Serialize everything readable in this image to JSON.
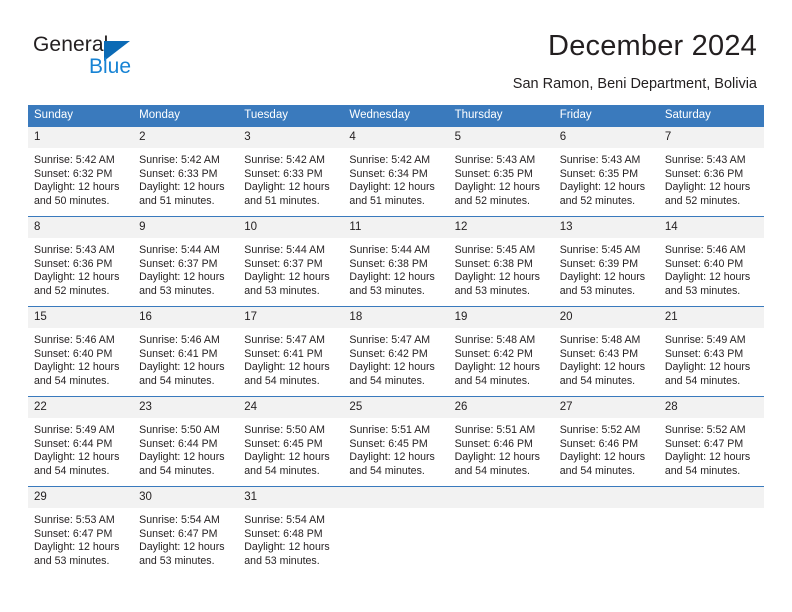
{
  "brand": {
    "name_top": "General",
    "name_bottom": "Blue",
    "triangle_color": "#0b6ab5",
    "blue_text_color": "#1783d4"
  },
  "header": {
    "title": "December 2024",
    "subtitle": "San Ramon, Beni Department, Bolivia",
    "header_bg": "#3a7abd",
    "header_text": "#ffffff"
  },
  "weekday_headers": [
    "Sunday",
    "Monday",
    "Tuesday",
    "Wednesday",
    "Thursday",
    "Friday",
    "Saturday"
  ],
  "weeks": [
    [
      {
        "day": "1",
        "sunrise": "Sunrise: 5:42 AM",
        "sunset": "Sunset: 6:32 PM",
        "daylight_line1": "Daylight: 12 hours",
        "daylight_line2": "and 50 minutes."
      },
      {
        "day": "2",
        "sunrise": "Sunrise: 5:42 AM",
        "sunset": "Sunset: 6:33 PM",
        "daylight_line1": "Daylight: 12 hours",
        "daylight_line2": "and 51 minutes."
      },
      {
        "day": "3",
        "sunrise": "Sunrise: 5:42 AM",
        "sunset": "Sunset: 6:33 PM",
        "daylight_line1": "Daylight: 12 hours",
        "daylight_line2": "and 51 minutes."
      },
      {
        "day": "4",
        "sunrise": "Sunrise: 5:42 AM",
        "sunset": "Sunset: 6:34 PM",
        "daylight_line1": "Daylight: 12 hours",
        "daylight_line2": "and 51 minutes."
      },
      {
        "day": "5",
        "sunrise": "Sunrise: 5:43 AM",
        "sunset": "Sunset: 6:35 PM",
        "daylight_line1": "Daylight: 12 hours",
        "daylight_line2": "and 52 minutes."
      },
      {
        "day": "6",
        "sunrise": "Sunrise: 5:43 AM",
        "sunset": "Sunset: 6:35 PM",
        "daylight_line1": "Daylight: 12 hours",
        "daylight_line2": "and 52 minutes."
      },
      {
        "day": "7",
        "sunrise": "Sunrise: 5:43 AM",
        "sunset": "Sunset: 6:36 PM",
        "daylight_line1": "Daylight: 12 hours",
        "daylight_line2": "and 52 minutes."
      }
    ],
    [
      {
        "day": "8",
        "sunrise": "Sunrise: 5:43 AM",
        "sunset": "Sunset: 6:36 PM",
        "daylight_line1": "Daylight: 12 hours",
        "daylight_line2": "and 52 minutes."
      },
      {
        "day": "9",
        "sunrise": "Sunrise: 5:44 AM",
        "sunset": "Sunset: 6:37 PM",
        "daylight_line1": "Daylight: 12 hours",
        "daylight_line2": "and 53 minutes."
      },
      {
        "day": "10",
        "sunrise": "Sunrise: 5:44 AM",
        "sunset": "Sunset: 6:37 PM",
        "daylight_line1": "Daylight: 12 hours",
        "daylight_line2": "and 53 minutes."
      },
      {
        "day": "11",
        "sunrise": "Sunrise: 5:44 AM",
        "sunset": "Sunset: 6:38 PM",
        "daylight_line1": "Daylight: 12 hours",
        "daylight_line2": "and 53 minutes."
      },
      {
        "day": "12",
        "sunrise": "Sunrise: 5:45 AM",
        "sunset": "Sunset: 6:38 PM",
        "daylight_line1": "Daylight: 12 hours",
        "daylight_line2": "and 53 minutes."
      },
      {
        "day": "13",
        "sunrise": "Sunrise: 5:45 AM",
        "sunset": "Sunset: 6:39 PM",
        "daylight_line1": "Daylight: 12 hours",
        "daylight_line2": "and 53 minutes."
      },
      {
        "day": "14",
        "sunrise": "Sunrise: 5:46 AM",
        "sunset": "Sunset: 6:40 PM",
        "daylight_line1": "Daylight: 12 hours",
        "daylight_line2": "and 53 minutes."
      }
    ],
    [
      {
        "day": "15",
        "sunrise": "Sunrise: 5:46 AM",
        "sunset": "Sunset: 6:40 PM",
        "daylight_line1": "Daylight: 12 hours",
        "daylight_line2": "and 54 minutes."
      },
      {
        "day": "16",
        "sunrise": "Sunrise: 5:46 AM",
        "sunset": "Sunset: 6:41 PM",
        "daylight_line1": "Daylight: 12 hours",
        "daylight_line2": "and 54 minutes."
      },
      {
        "day": "17",
        "sunrise": "Sunrise: 5:47 AM",
        "sunset": "Sunset: 6:41 PM",
        "daylight_line1": "Daylight: 12 hours",
        "daylight_line2": "and 54 minutes."
      },
      {
        "day": "18",
        "sunrise": "Sunrise: 5:47 AM",
        "sunset": "Sunset: 6:42 PM",
        "daylight_line1": "Daylight: 12 hours",
        "daylight_line2": "and 54 minutes."
      },
      {
        "day": "19",
        "sunrise": "Sunrise: 5:48 AM",
        "sunset": "Sunset: 6:42 PM",
        "daylight_line1": "Daylight: 12 hours",
        "daylight_line2": "and 54 minutes."
      },
      {
        "day": "20",
        "sunrise": "Sunrise: 5:48 AM",
        "sunset": "Sunset: 6:43 PM",
        "daylight_line1": "Daylight: 12 hours",
        "daylight_line2": "and 54 minutes."
      },
      {
        "day": "21",
        "sunrise": "Sunrise: 5:49 AM",
        "sunset": "Sunset: 6:43 PM",
        "daylight_line1": "Daylight: 12 hours",
        "daylight_line2": "and 54 minutes."
      }
    ],
    [
      {
        "day": "22",
        "sunrise": "Sunrise: 5:49 AM",
        "sunset": "Sunset: 6:44 PM",
        "daylight_line1": "Daylight: 12 hours",
        "daylight_line2": "and 54 minutes."
      },
      {
        "day": "23",
        "sunrise": "Sunrise: 5:50 AM",
        "sunset": "Sunset: 6:44 PM",
        "daylight_line1": "Daylight: 12 hours",
        "daylight_line2": "and 54 minutes."
      },
      {
        "day": "24",
        "sunrise": "Sunrise: 5:50 AM",
        "sunset": "Sunset: 6:45 PM",
        "daylight_line1": "Daylight: 12 hours",
        "daylight_line2": "and 54 minutes."
      },
      {
        "day": "25",
        "sunrise": "Sunrise: 5:51 AM",
        "sunset": "Sunset: 6:45 PM",
        "daylight_line1": "Daylight: 12 hours",
        "daylight_line2": "and 54 minutes."
      },
      {
        "day": "26",
        "sunrise": "Sunrise: 5:51 AM",
        "sunset": "Sunset: 6:46 PM",
        "daylight_line1": "Daylight: 12 hours",
        "daylight_line2": "and 54 minutes."
      },
      {
        "day": "27",
        "sunrise": "Sunrise: 5:52 AM",
        "sunset": "Sunset: 6:46 PM",
        "daylight_line1": "Daylight: 12 hours",
        "daylight_line2": "and 54 minutes."
      },
      {
        "day": "28",
        "sunrise": "Sunrise: 5:52 AM",
        "sunset": "Sunset: 6:47 PM",
        "daylight_line1": "Daylight: 12 hours",
        "daylight_line2": "and 54 minutes."
      }
    ],
    [
      {
        "day": "29",
        "sunrise": "Sunrise: 5:53 AM",
        "sunset": "Sunset: 6:47 PM",
        "daylight_line1": "Daylight: 12 hours",
        "daylight_line2": "and 53 minutes."
      },
      {
        "day": "30",
        "sunrise": "Sunrise: 5:54 AM",
        "sunset": "Sunset: 6:47 PM",
        "daylight_line1": "Daylight: 12 hours",
        "daylight_line2": "and 53 minutes."
      },
      {
        "day": "31",
        "sunrise": "Sunrise: 5:54 AM",
        "sunset": "Sunset: 6:48 PM",
        "daylight_line1": "Daylight: 12 hours",
        "daylight_line2": "and 53 minutes."
      },
      {
        "day": "",
        "sunrise": "",
        "sunset": "",
        "daylight_line1": "",
        "daylight_line2": ""
      },
      {
        "day": "",
        "sunrise": "",
        "sunset": "",
        "daylight_line1": "",
        "daylight_line2": ""
      },
      {
        "day": "",
        "sunrise": "",
        "sunset": "",
        "daylight_line1": "",
        "daylight_line2": ""
      },
      {
        "day": "",
        "sunrise": "",
        "sunset": "",
        "daylight_line1": "",
        "daylight_line2": ""
      }
    ]
  ]
}
